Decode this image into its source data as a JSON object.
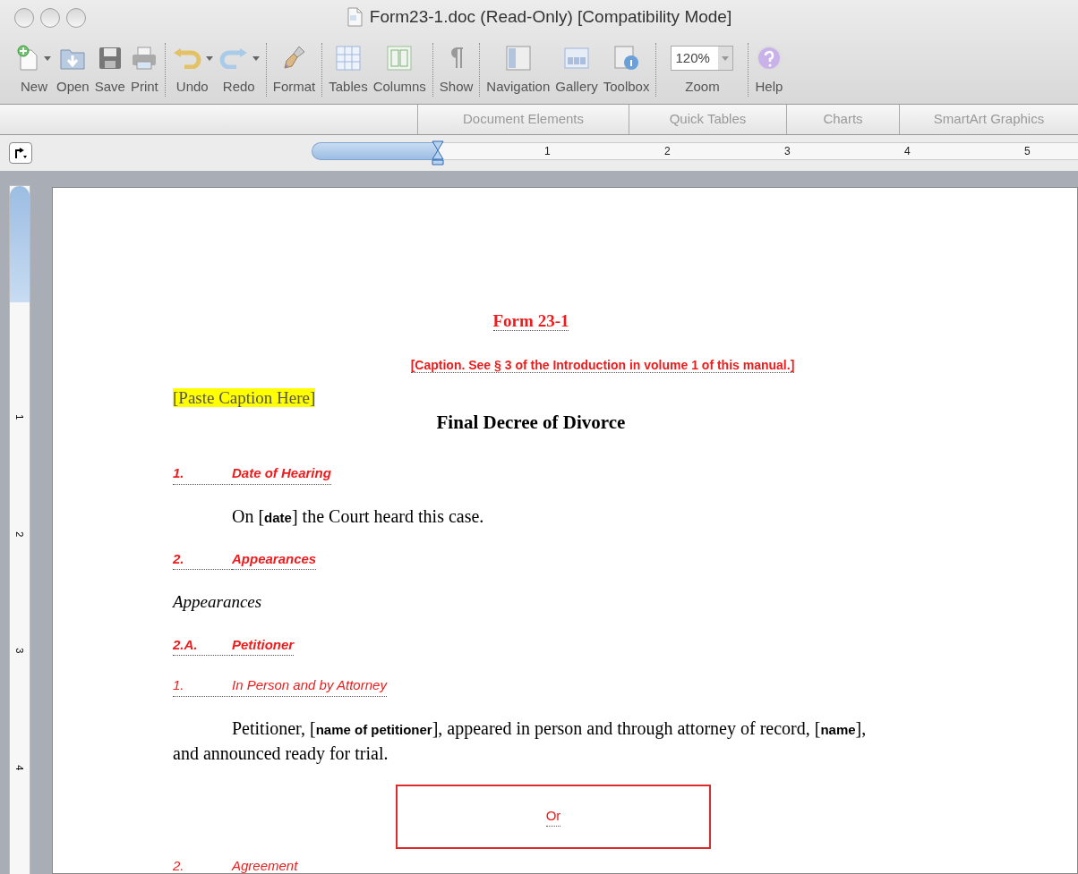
{
  "window": {
    "title": "Form23-1.doc (Read-Only) [Compatibility Mode]"
  },
  "toolbar": {
    "groups": [
      [
        {
          "kind": "new",
          "label": "New",
          "dropdown": true
        },
        {
          "kind": "open",
          "label": "Open",
          "dropdown": false
        },
        {
          "kind": "save",
          "label": "Save",
          "dropdown": false
        },
        {
          "kind": "print",
          "label": "Print",
          "dropdown": false
        }
      ],
      [
        {
          "kind": "undo",
          "label": "Undo",
          "dropdown": true
        },
        {
          "kind": "redo",
          "label": "Redo",
          "dropdown": true
        }
      ],
      [
        {
          "kind": "format",
          "label": "Format",
          "dropdown": false
        }
      ],
      [
        {
          "kind": "tables",
          "label": "Tables",
          "dropdown": false
        },
        {
          "kind": "columns",
          "label": "Columns",
          "dropdown": false
        }
      ],
      [
        {
          "kind": "show",
          "label": "Show",
          "dropdown": false
        }
      ],
      [
        {
          "kind": "navigation",
          "label": "Navigation",
          "dropdown": false
        },
        {
          "kind": "gallery",
          "label": "Gallery",
          "dropdown": false
        },
        {
          "kind": "toolbox",
          "label": "Toolbox",
          "dropdown": false
        }
      ],
      [
        {
          "kind": "zoom",
          "label": "Zoom",
          "value": "120%"
        }
      ],
      [
        {
          "kind": "help",
          "label": "Help",
          "dropdown": false
        }
      ]
    ]
  },
  "ribbon_tabs": [
    "Document Elements",
    "Quick Tables",
    "Charts",
    "SmartArt Graphics"
  ],
  "ruler": {
    "numbers": [
      "1",
      "2",
      "3",
      "4",
      "5"
    ]
  },
  "vertical_ruler": {
    "numbers": [
      "1",
      "2",
      "3",
      "4"
    ]
  },
  "document": [
    {
      "kind": "title",
      "text": "Form 23-1"
    },
    {
      "kind": "note",
      "text": "[Caption. See § 3 of the Introduction in volume 1 of this manual.]"
    },
    {
      "kind": "highlight",
      "text": "[Paste Caption Here]"
    },
    {
      "kind": "heading",
      "text": "Final Decree of Divorce"
    },
    {
      "kind": "section",
      "number": "1.",
      "label": "Date of Hearing"
    },
    {
      "kind": "body",
      "text": "On [**date**] the Court heard this case."
    },
    {
      "kind": "section",
      "number": "2.",
      "label": "Appearances"
    },
    {
      "kind": "italic",
      "text": "Appearances"
    },
    {
      "kind": "section",
      "number": "2.A.",
      "label": "Petitioner"
    },
    {
      "kind": "subsection",
      "number": "1.",
      "label": "In Person and by Attorney"
    },
    {
      "kind": "body",
      "text": "Petitioner, [**name of petitioner**], appeared in person and through attorney of record, [**name**], and announced ready for trial."
    },
    {
      "kind": "box",
      "text": "Or"
    },
    {
      "kind": "subsection",
      "number": "2.",
      "label": "Agreement"
    }
  ]
}
